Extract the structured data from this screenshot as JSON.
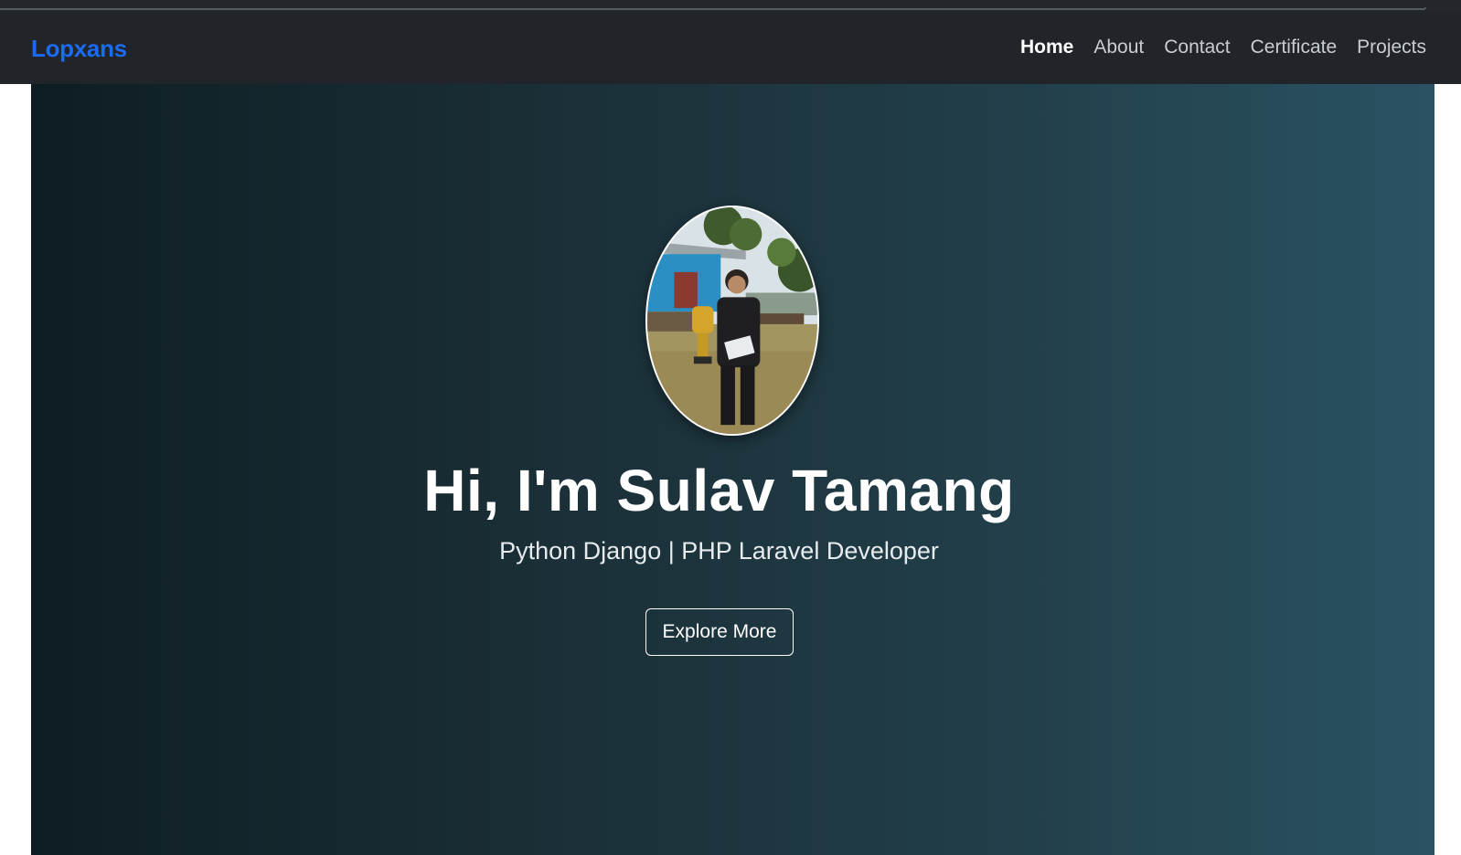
{
  "navbar": {
    "brand": "Lopxans",
    "links": [
      "Home",
      "About",
      "Contact",
      "Certificate",
      "Projects"
    ],
    "active": "Home"
  },
  "hero": {
    "title": "Hi, I'm Sulav Tamang",
    "subtitle": "Python Django | PHP Laravel Developer",
    "cta_label": "Explore More"
  },
  "colors": {
    "navbar_bg": "#212529",
    "brand": "#1b6cf2",
    "hero_gradient_start": "#0e1d23",
    "hero_gradient_end": "#2a5263"
  }
}
